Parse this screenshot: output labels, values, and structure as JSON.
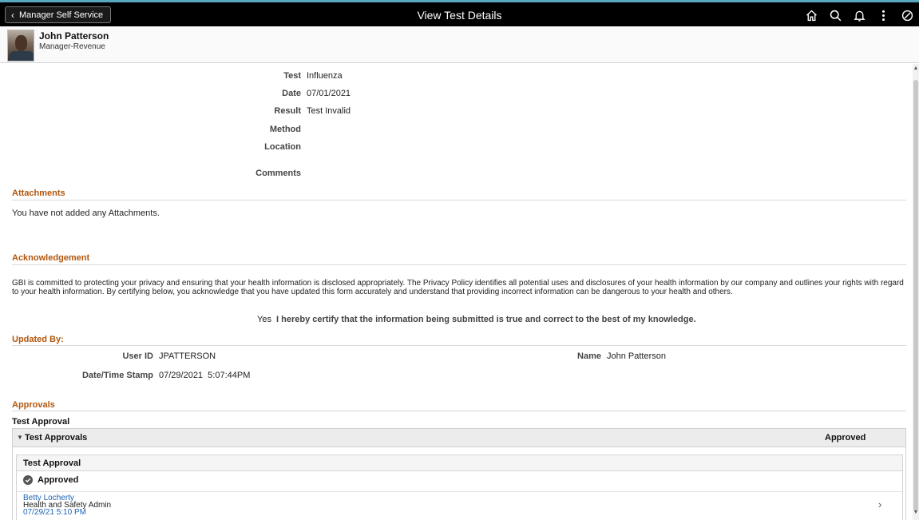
{
  "topbar": {
    "back_label": "Manager Self Service",
    "title": "View Test Details",
    "icons": [
      "home-icon",
      "search-icon",
      "bell-icon",
      "more-icon",
      "nav-icon"
    ]
  },
  "employee": {
    "name": "John Patterson",
    "job": "Manager-Revenue"
  },
  "test": {
    "test_label": "Test",
    "test_value": "Influenza",
    "date_label": "Date",
    "date_value": "07/01/2021",
    "result_label": "Result",
    "result_value": "Test Invalid",
    "method_label": "Method",
    "method_value": "",
    "location_label": "Location",
    "location_value": "",
    "comments_label": "Comments",
    "comments_value": ""
  },
  "attachments": {
    "title": "Attachments",
    "empty_text": "You have not added any Attachments."
  },
  "acknowledgement": {
    "title": "Acknowledgement",
    "text": "GBI is committed to protecting your privacy and ensuring that your health information is disclosed appropriately. The Privacy Policy identifies all potential uses and disclosures of your health information by our company and outlines your rights with regard to your health information. By certifying below, you acknowledge that you have updated this form accurately and understand that providing incorrect information can be dangerous to your health and others.",
    "certify_value": "Yes",
    "certify_text": "I hereby certify that the information being submitted is true and correct to the best of my knowledge."
  },
  "updated_by": {
    "title": "Updated By:",
    "userid_label": "User ID",
    "userid_value": "JPATTERSON",
    "name_label": "Name",
    "name_value": "John Patterson",
    "datetime_label": "Date/Time Stamp",
    "datetime_value": "07/29/2021  5:07:44PM"
  },
  "approvals": {
    "title": "Approvals",
    "group_title": "Test Approval",
    "header_title": "Test Approvals",
    "header_status": "Approved",
    "inner_title": "Test Approval",
    "status": "Approved",
    "approver_name": "Betty Locherty",
    "approver_role": "Health and Safety Admin",
    "approver_datetime": "07/29/21 5:10 PM"
  },
  "colors": {
    "section_title": "#b2560d",
    "link": "#1f63b5",
    "banner": "#000000"
  }
}
